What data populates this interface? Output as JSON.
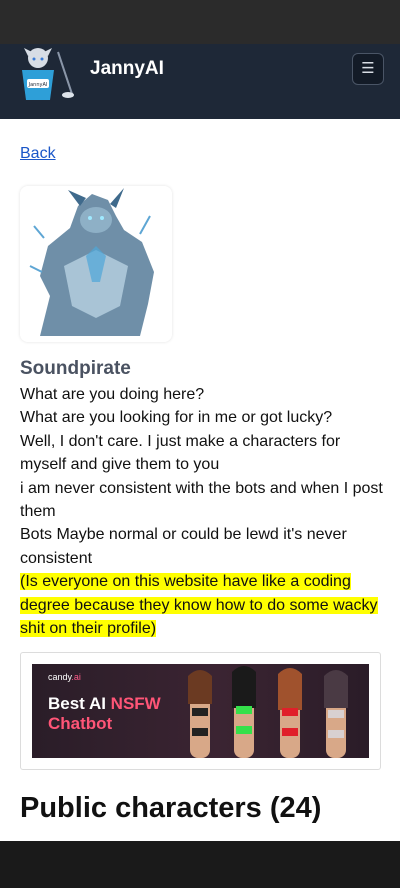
{
  "header": {
    "brand": "JannyAI",
    "menu_icon": "hamburger-icon",
    "logo_label": "JannyAI"
  },
  "profile": {
    "back_label": "Back",
    "username": "Soundpirate",
    "bio_lines": [
      "What are you doing here?",
      "What are you looking for in me or got lucky?",
      "Well, I don't care. I just make a characters for myself and give them to you",
      "i am never consistent with the bots and when I post them",
      "Bots Maybe normal or could be lewd it's never consistent"
    ],
    "bio_highlight": "(Is everyone on this website have like a coding degree because they know how to do some wacky shit on their profile)"
  },
  "ad": {
    "brand_name": "candy",
    "brand_suffix": ".ai",
    "title_prefix": "Best AI ",
    "title_highlight": "NSFW",
    "title_suffix": "Chatbot"
  },
  "sections": {
    "public_characters": "Public characters (24)"
  },
  "colors": {
    "navbar": "#1e2837",
    "link": "#1a56c8",
    "highlight": "#ffff00",
    "ad_accent": "#ff5577"
  }
}
